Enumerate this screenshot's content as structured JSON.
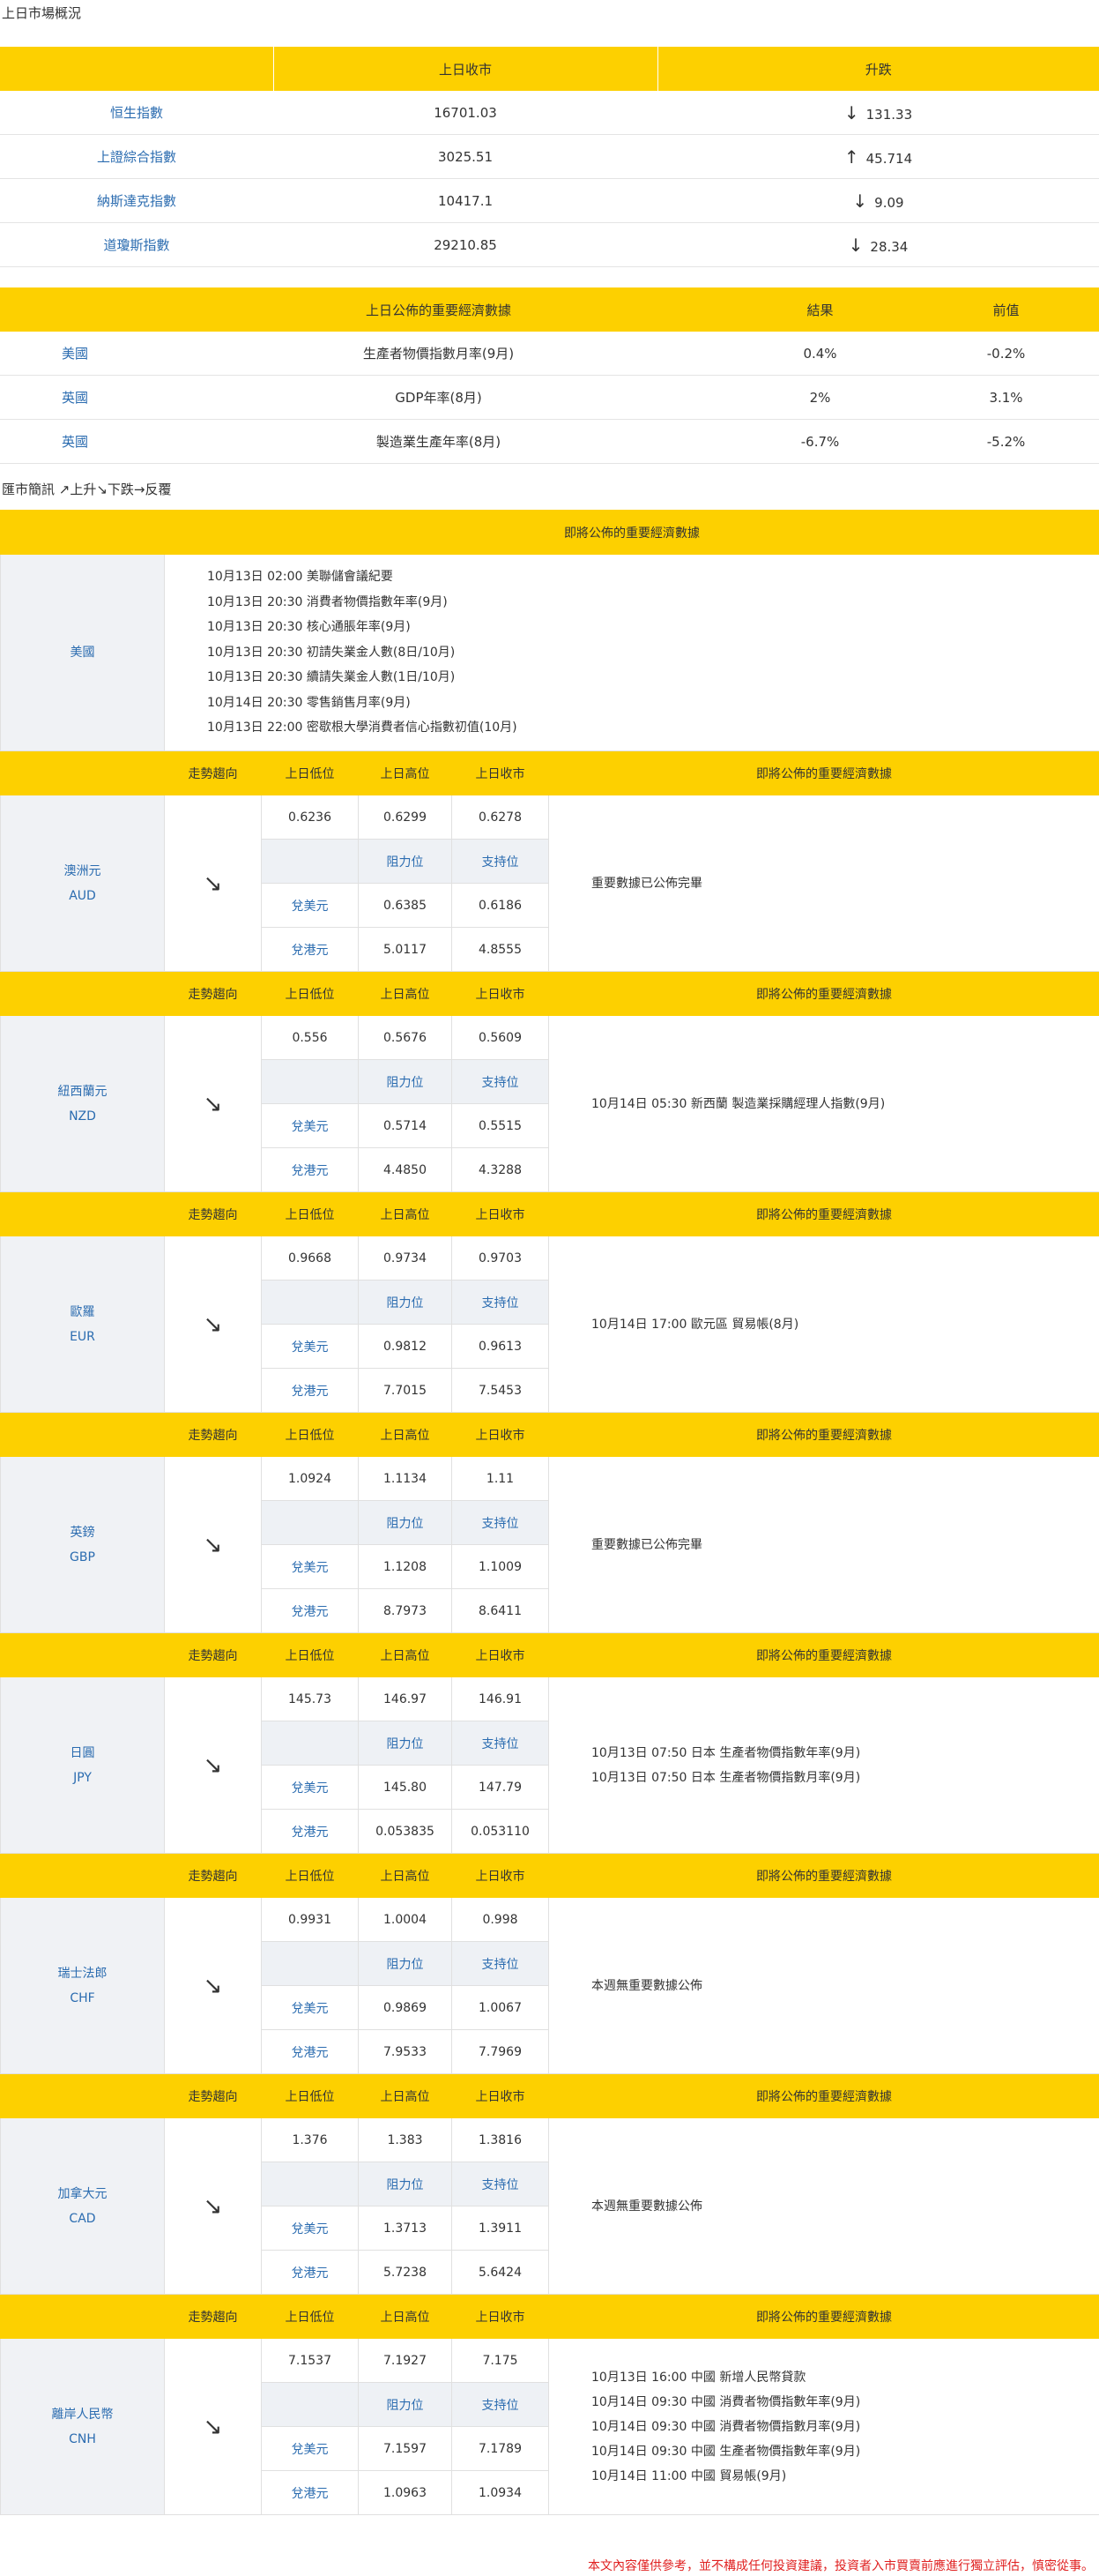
{
  "market": {
    "title": "上日市場概況",
    "headers": [
      "",
      "上日收市",
      "升跌"
    ],
    "rows": [
      {
        "name": "恒生指數",
        "close": "16701.03",
        "arrow": "↓",
        "change": "131.33"
      },
      {
        "name": "上證綜合指數",
        "close": "3025.51",
        "arrow": "↑",
        "change": "45.714"
      },
      {
        "name": "納斯達克指數",
        "close": "10417.1",
        "arrow": "↓",
        "change": "9.09"
      },
      {
        "name": "道瓊斯指數",
        "close": "29210.85",
        "arrow": "↓",
        "change": "28.34"
      }
    ]
  },
  "econ": {
    "headers": [
      "",
      "上日公佈的重要經濟數據",
      "結果",
      "前值"
    ],
    "rows": [
      {
        "country": "美國",
        "item": "生產者物價指數月率(9月)",
        "result": "0.4%",
        "prev": "-0.2%"
      },
      {
        "country": "英國",
        "item": "GDP年率(8月)",
        "result": "2%",
        "prev": "3.1%"
      },
      {
        "country": "英國",
        "item": "製造業生產年率(8月)",
        "result": "-6.7%",
        "prev": "-5.2%"
      }
    ]
  },
  "fx": {
    "title": "匯市簡訊 ↗上升↘下跌→反覆",
    "upcoming_header": "即將公佈的重要經濟數據",
    "us": {
      "name": "美國",
      "events": [
        "10月13日 02:00 美聯儲會議紀要",
        "10月13日 20:30 消費者物價指數年率(9月)",
        "10月13日 20:30 核心通脹年率(9月)",
        "10月13日 20:30 初請失業金人數(8日/10月)",
        "10月13日 20:30 續請失業金人數(1日/10月)",
        "10月14日 20:30 零售銷售月率(9月)",
        "10月13日 22:00 密歇根大學消費者信心指數初值(10月)"
      ]
    },
    "col_headers": {
      "trend": "走勢趨向",
      "low": "上日低位",
      "high": "上日高位",
      "close": "上日收市",
      "upcoming": "即將公佈的重要經濟數據"
    },
    "res_label": "阻力位",
    "sup_label": "支持位",
    "usd_label": "兌美元",
    "hkd_label": "兌港元",
    "currencies": [
      {
        "name": "澳洲元",
        "code": "AUD",
        "trend": "↘",
        "low": "0.6236",
        "high": "0.6299",
        "close": "0.6278",
        "usd_res": "0.6385",
        "usd_sup": "0.6186",
        "hkd_res": "5.0117",
        "hkd_sup": "4.8555",
        "events": [
          "重要數據已公佈完畢"
        ]
      },
      {
        "name": "紐西蘭元",
        "code": "NZD",
        "trend": "↘",
        "low": "0.556",
        "high": "0.5676",
        "close": "0.5609",
        "usd_res": "0.5714",
        "usd_sup": "0.5515",
        "hkd_res": "4.4850",
        "hkd_sup": "4.3288",
        "events": [
          "10月14日 05:30 新西蘭 製造業採購經理人指數(9月)"
        ]
      },
      {
        "name": "歐羅",
        "code": "EUR",
        "trend": "↘",
        "low": "0.9668",
        "high": "0.9734",
        "close": "0.9703",
        "usd_res": "0.9812",
        "usd_sup": "0.9613",
        "hkd_res": "7.7015",
        "hkd_sup": "7.5453",
        "events": [
          "10月14日 17:00 歐元區 貿易帳(8月)"
        ]
      },
      {
        "name": "英鎊",
        "code": "GBP",
        "trend": "↘",
        "low": "1.0924",
        "high": "1.1134",
        "close": "1.11",
        "usd_res": "1.1208",
        "usd_sup": "1.1009",
        "hkd_res": "8.7973",
        "hkd_sup": "8.6411",
        "events": [
          "重要數據已公佈完畢"
        ]
      },
      {
        "name": "日圓",
        "code": "JPY",
        "trend": "↘",
        "low": "145.73",
        "high": "146.97",
        "close": "146.91",
        "usd_res": "145.80",
        "usd_sup": "147.79",
        "hkd_res": "0.053835",
        "hkd_sup": "0.053110",
        "events": [
          "10月13日 07:50 日本 生產者物價指數年率(9月)",
          "10月13日 07:50 日本 生產者物價指數月率(9月)"
        ]
      },
      {
        "name": "瑞士法郎",
        "code": "CHF",
        "trend": "↘",
        "low": "0.9931",
        "high": "1.0004",
        "close": "0.998",
        "usd_res": "0.9869",
        "usd_sup": "1.0067",
        "hkd_res": "7.9533",
        "hkd_sup": "7.7969",
        "events": [
          "本週無重要數據公佈"
        ]
      },
      {
        "name": "加拿大元",
        "code": "CAD",
        "trend": "↘",
        "low": "1.376",
        "high": "1.383",
        "close": "1.3816",
        "usd_res": "1.3713",
        "usd_sup": "1.3911",
        "hkd_res": "5.7238",
        "hkd_sup": "5.6424",
        "events": [
          "本週無重要數據公佈"
        ]
      },
      {
        "name": "離岸人民幣",
        "code": "CNH",
        "trend": "↘",
        "low": "7.1537",
        "high": "7.1927",
        "close": "7.175",
        "usd_res": "7.1597",
        "usd_sup": "7.1789",
        "hkd_res": "1.0963",
        "hkd_sup": "1.0934",
        "events": [
          "10月13日 16:00 中國 新增人民幣貸款",
          "10月14日 09:30 中國 消費者物價指數年率(9月)",
          "10月14日 09:30 中國 消費者物價指數月率(9月)",
          "10月14日 09:30 中國 生產者物價指數年率(9月)",
          "10月14日 11:00 中國 貿易帳(9月)"
        ]
      }
    ]
  },
  "footer": "本文內容僅供參考，並不構成任何投資建議，投資者入市買賣前應進行獨立評估，慎密從事。"
}
